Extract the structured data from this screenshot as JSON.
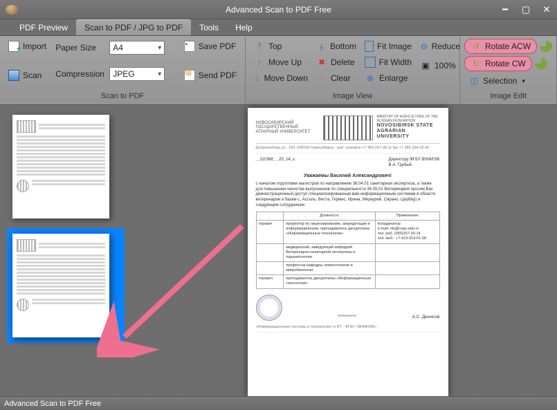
{
  "titlebar": {
    "title": "Advanced Scan to PDF Free"
  },
  "tabs": {
    "pdf_preview": "PDF Preview",
    "scan_tab": "Scan to PDF / JPG to PDF",
    "tools": "Tools",
    "help": "Help"
  },
  "ribbon": {
    "group1": {
      "import": "Import",
      "scan": "Scan",
      "paper_size_label": "Paper Size",
      "paper_size_value": "A4",
      "compression_label": "Compression",
      "compression_value": "JPEG",
      "save_pdf": "Save PDF",
      "send_pdf": "Send PDF",
      "label": "Scan to PDF"
    },
    "group2": {
      "top": "Top",
      "move_up": "Move Up",
      "move_down": "Move Down",
      "bottom": "Bottom",
      "delete": "Delete",
      "clear": "Clear",
      "fit_image": "Fit Image",
      "fit_width": "Fit Width",
      "enlarge": "Enlarge",
      "reduce": "Reduce",
      "hundred": "100%",
      "label": "Image View"
    },
    "group3": {
      "rotate_acw": "Rotate ACW",
      "rotate_cw": "Rotate CW",
      "selection": "Selection",
      "label": "Image Edit"
    }
  },
  "document": {
    "org_left": "НОВОСИБИРСКИЙ ГОСУДАРСТВЕННЫЙ АГРАРНЫЙ УНИВЕРСИТЕТ",
    "ministry": "MINISTRY OF AGRICULTURE OF THE RUSSIAN FEDERATION",
    "uni": "NOVOSIBIRSK STATE AGRARIAN UNIVERSITY",
    "contact": "Добролюбова ул., 160, 630039 Новосибирск · раб. телефон +7 383 267-38-11 fax +7 383 264-26-00",
    "date_no": "__02/368__ 20_14_г.",
    "to": "Директору ФГБУ ВНИИЗЖ\nВ.А. Грубый",
    "salutation": "Уважаемы Василий Александрович!",
    "body": "с началом подготовки магистров по направлению 36.04.01 санитарная экспертиза, а также для повышения качества выпускников по специальности 36.05.01 Ветеринария просим Вас демонстрационный доступ специализированным вам информационным системам в области ветеринарии и базам с, Ассоль, Веста, Гермес, Ирена, Меркурий, Сирано, Цербер) и следующим сотрудникам:",
    "th1": "Должность",
    "th2": "Примечание",
    "r1c0": "горович",
    "r1c1": "проректор по лицензированию, аккредитации и информационным, преподаватель дисциплины «Информационные технологии»",
    "r1c2": "Координатор\ne-mail: nlv@nsau.edu.ru\nтел. раб. (383)267-39-14\nтел. моб.: +7-913-913-01-58",
    "r2c1": "медицинский, заведующий кафедрой Ветеринарно-санитарной экспертизы и паразитологии",
    "r3c1": "профессор кафедры эпизоотологии и микробиологии",
    "r4c0": "торович",
    "r4c1": "преподаватель дисциплины «Информационные технологии»",
    "signer": "А.С. Денисов",
    "footer": "«Информационные системы и технологии» в ИТ · ФГБУ «ВНИИЗЖ»"
  },
  "statusbar": {
    "text": "Advanced Scan to PDF Free"
  }
}
